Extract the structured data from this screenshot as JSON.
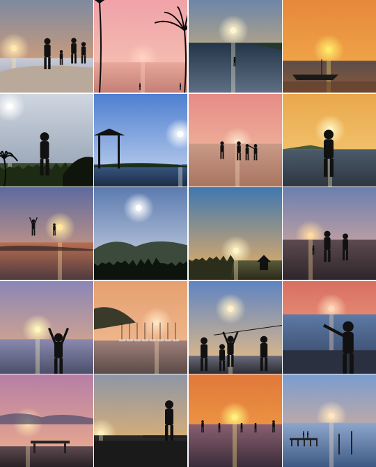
{
  "gallery": {
    "columns": 4,
    "rows": 5,
    "tiles": [
      {
        "sky": [
          "#7d8aa0",
          "#f2a46a"
        ],
        "water": [
          "#c9ccd6",
          "#8f95a8"
        ],
        "sun": "#ffe7b0",
        "scene": "rock-group"
      },
      {
        "sky": [
          "#f0a2a8",
          "#f6c7b4"
        ],
        "water": [
          "#e8a89c",
          "#c47f76"
        ],
        "sun": "#ffd0c0",
        "scene": "palm-beach"
      },
      {
        "sky": [
          "#6d85a8",
          "#f1c16e"
        ],
        "water": [
          "#233548",
          "#5e6f84"
        ],
        "sun": "#fff5cf",
        "scene": "sun-sea"
      },
      {
        "sky": [
          "#e5883a",
          "#f5b04f"
        ],
        "water": [
          "#5b4d4a",
          "#8a5a3a"
        ],
        "sun": "#ffea6a",
        "scene": "boat"
      },
      {
        "sky": [
          "#cfd6e0",
          "#8e9cae"
        ],
        "water": [
          "#3c4c2e",
          "#1f2a1a"
        ],
        "sun": "#ffffff",
        "scene": "hilltop"
      },
      {
        "sky": [
          "#4e7fd1",
          "#c7d7ef"
        ],
        "water": [
          "#3a5a86",
          "#1c2c44"
        ],
        "sun": "#ffffff",
        "scene": "swing"
      },
      {
        "sky": [
          "#e68c86",
          "#f4c4a4"
        ],
        "water": [
          "#c99a86",
          "#a87460"
        ],
        "sun": "#fbe0c8",
        "scene": "beach-walkers"
      },
      {
        "sky": [
          "#e9a84c",
          "#f7cf7c"
        ],
        "water": [
          "#4b5b6b",
          "#2e3640"
        ],
        "sun": "#fff4c0",
        "scene": "standing-sun"
      },
      {
        "sky": [
          "#5c6aa0",
          "#f2a778"
        ],
        "water": [
          "#b86d4e",
          "#4e3a40"
        ],
        "sun": "#ffe6a0",
        "scene": "jumpers"
      },
      {
        "sky": [
          "#5b7bb0",
          "#d6dbe6"
        ],
        "water": [
          "#27362a",
          "#121a13"
        ],
        "sun": "#ffffff",
        "scene": "valley"
      },
      {
        "sky": [
          "#3e78b0",
          "#f0b060"
        ],
        "water": [
          "#5a5a3a",
          "#2a2a1a"
        ],
        "sun": "#fff4c8",
        "scene": "hut"
      },
      {
        "sky": [
          "#6a7fb0",
          "#f3b39a"
        ],
        "water": [
          "#5c4a50",
          "#2e262a"
        ],
        "sun": "#ffd9a0",
        "scene": "couple-beach"
      },
      {
        "sky": [
          "#8a86b6",
          "#f1b07e"
        ],
        "water": [
          "#8a8ab0",
          "#4a4f6a"
        ],
        "sun": "#fff6b8",
        "scene": "hands-up"
      },
      {
        "sky": [
          "#e6a070",
          "#f2c19a"
        ],
        "water": [
          "#a0807a",
          "#5a4a46"
        ],
        "sun": "#ffe2c0",
        "scene": "harbor"
      },
      {
        "sky": [
          "#5f84c2",
          "#f0c080"
        ],
        "water": [
          "#6a6a7a",
          "#2c2c34"
        ],
        "sun": "#fff0c8",
        "scene": "volleyball"
      },
      {
        "sky": [
          "#d86f62",
          "#f4b08a"
        ],
        "water": [
          "#5e7aa6",
          "#2e3e5c"
        ],
        "sun": "#ffd8b8",
        "scene": "sun-hold"
      },
      {
        "sky": [
          "#b67ea6",
          "#f0b08a"
        ],
        "water": [
          "#5e4a50",
          "#2a2226"
        ],
        "sun": "#ffe0b0",
        "scene": "pier-clouds"
      },
      {
        "sky": [
          "#8e96a6",
          "#f5b864"
        ],
        "water": [
          "#2a2a2a",
          "#111111"
        ],
        "sun": "#fff0c0",
        "scene": "rock-statue"
      },
      {
        "sky": [
          "#e0783a",
          "#f6a84a"
        ],
        "water": [
          "#8a6070",
          "#3a2c3a"
        ],
        "sun": "#fff07a",
        "scene": "shore-people"
      },
      {
        "sky": [
          "#7a9ccf",
          "#f4b488"
        ],
        "water": [
          "#8ea6cc",
          "#3e5a84"
        ],
        "sun": "#ffe6c0",
        "scene": "jetty"
      }
    ]
  }
}
